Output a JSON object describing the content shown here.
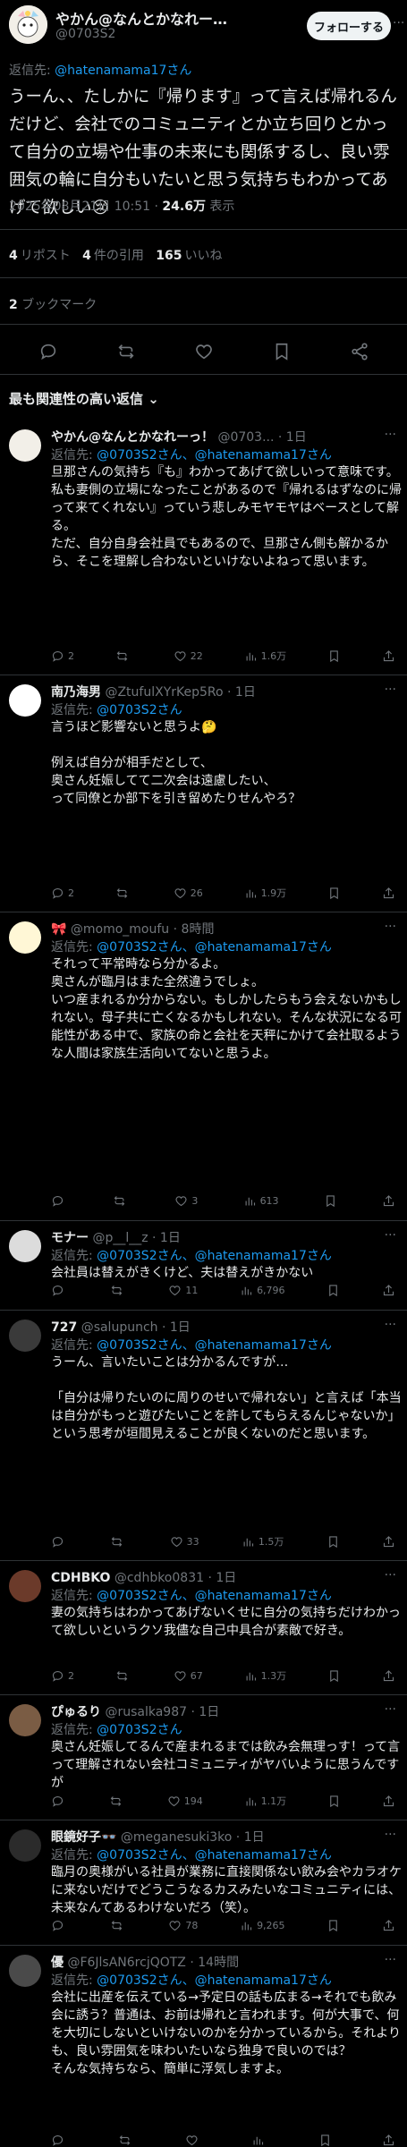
{
  "post": {
    "author_name": "やかん@なんとかなれー…",
    "author_handle": "@0703S2",
    "follow_label": "フォローする",
    "more": "···",
    "reply_to_prefix": "返信先: ",
    "reply_to_handle": "@hatenamama17さん",
    "text": "うーん、、たしかに『帰ります』って言えば帰れるんだけど、会社でのコミュニティとか立ち回りとかって自分の立場や仕事の未来にも関係するし、良い雰囲気の輪に自分もいたいと思う気持ちもわかってあげて欲しい😢",
    "timestamp": "2025年08月21日 10:51 · ",
    "views": "24.6万",
    "views_label": " 表示",
    "reposts": "4",
    "reposts_label": "リポスト",
    "quotes": "4",
    "quotes_label": "件の引用",
    "likes": "165",
    "likes_label": "いいね",
    "bookmarks": "2",
    "bookmarks_label": "ブックマーク"
  },
  "sort_label": "最も関連性の高い返信 ⌄",
  "replies": [
    {
      "name": "やかん@なんとかなれーっ！",
      "handle": "@0703...",
      "time": "· 1日",
      "to_prefix": "返信先: ",
      "to_handles": "@0703S2さん、@hatenamama17さん",
      "text": "旦那さんの気持ち『も』わかってあげて欲しいって意味です。\n私も妻側の立場になったことがあるので『帰れるはずなのに帰って来てくれない』っていう悲しみモヤモヤはベースとして解る。\nただ、自分自身会社員でもあるので、旦那さん側も解かるから、そこを理解し合わないといけないよねって思います。",
      "replies": "2",
      "reposts": "",
      "likes": "22",
      "views": "1.6万"
    },
    {
      "name": "南乃海男",
      "handle": "@ZtufulXYrKep5Ro",
      "time": "· 1日",
      "to_prefix": "返信先: ",
      "to_handles": "@0703S2さん",
      "text": "言うほど影響ないと思うよ🤔\n\n例えば自分が相手だとして、\n奥さん妊娠してて二次会は遠慮したい、\nって同僚とか部下を引き留めたりせんやろ？",
      "replies": "2",
      "reposts": "",
      "likes": "26",
      "views": "1.9万"
    },
    {
      "name": "🎀",
      "handle": "@momo_moufu",
      "time": "· 8時間",
      "to_prefix": "返信先: ",
      "to_handles": "@0703S2さん、@hatenamama17さん",
      "text": "それって平常時なら分かるよ。\n奥さんが臨月はまた全然違うでしょ。\nいつ産まれるか分からない。もしかしたらもう会えないかもしれない。母子共に亡くなるかもしれない。そんな状況になる可能性がある中で、家族の命と会社を天秤にかけて会社取るような人間は家族生活向いてないと思うよ。",
      "replies": "",
      "reposts": "",
      "likes": "3",
      "views": "613"
    },
    {
      "name": "モナー",
      "handle": "@p__l__z",
      "time": "· 1日",
      "to_prefix": "返信先: ",
      "to_handles": "@0703S2さん、@hatenamama17さん",
      "text": "会社員は替えがきくけど、夫は替えがきかない",
      "replies": "",
      "reposts": "",
      "likes": "11",
      "views": "6,796"
    },
    {
      "name": "727",
      "handle": "@salupunch",
      "time": "· 1日",
      "to_prefix": "返信先: ",
      "to_handles": "@0703S2さん、@hatenamama17さん",
      "text": "うーん、言いたいことは分かるんですが…\n\n「自分は帰りたいのに周りのせいで帰れない」と言えば「本当は自分がもっと遊びたいことを許してもらえるんじゃないか」という思考が垣間見えることが良くないのだと思います。",
      "replies": "",
      "reposts": "",
      "likes": "33",
      "views": "1.5万"
    },
    {
      "name": "CDHBKO",
      "handle": "@cdhbko0831",
      "time": "· 1日",
      "to_prefix": "返信先: ",
      "to_handles": "@0703S2さん、@hatenamama17さん",
      "text": "妻の気持ちはわかってあげないくせに自分の気持ちだけわかって欲しいというクソ我儘な自己中具合が素敵で好き。",
      "replies": "2",
      "reposts": "",
      "likes": "67",
      "views": "1.3万"
    },
    {
      "name": "ぴゅるり",
      "handle": "@rusalka987",
      "time": "· 1日",
      "to_prefix": "返信先: ",
      "to_handles": "@0703S2さん",
      "text": "奥さん妊娠してるんで産まれるまでは飲み会無理っす！って言って理解されない会社コミュニティがヤバいように思うんですが",
      "replies": "",
      "reposts": "",
      "likes": "194",
      "views": "1.1万"
    },
    {
      "name": "眼鏡好子👓",
      "handle": "@meganesuki3ko",
      "time": "· 1日",
      "to_prefix": "返信先: ",
      "to_handles": "@0703S2さん、@hatenamama17さん",
      "text": "臨月の奥様がいる社員が業務に直接関係ない飲み会やカラオケに来ないだけでどうこうなるカスみたいなコミュニティには、未来なんてあるわけないだろ（笑）。",
      "replies": "",
      "reposts": "",
      "likes": "78",
      "views": "9,265"
    },
    {
      "name": "優",
      "handle": "@F6JlsAN6rcjQOTZ",
      "time": "· 14時間",
      "to_prefix": "返信先: ",
      "to_handles": "@0703S2さん、@hatenamama17さん",
      "text": "会社に出産を伝えている→予定日の話も広まる→それでも飲み会に誘う？普通は、お前は帰れと言われます。何が大事で、何を大切にしないといけないのかを分かっているから。それよりも、良い雰囲気を味わいたいなら独身で良いのでは？\nそんな気持ちなら、簡単に浮気しますよ。",
      "replies": "",
      "reposts": "",
      "likes": "",
      "views": ""
    }
  ],
  "icons": [
    "reply-icon",
    "repost-icon",
    "like-icon",
    "bookmark-icon",
    "share-icon",
    "views-icon"
  ],
  "colors": {
    "accent": "#1d9bf0",
    "muted": "#71767b",
    "text": "#e7e9ea",
    "bg": "#000000"
  }
}
